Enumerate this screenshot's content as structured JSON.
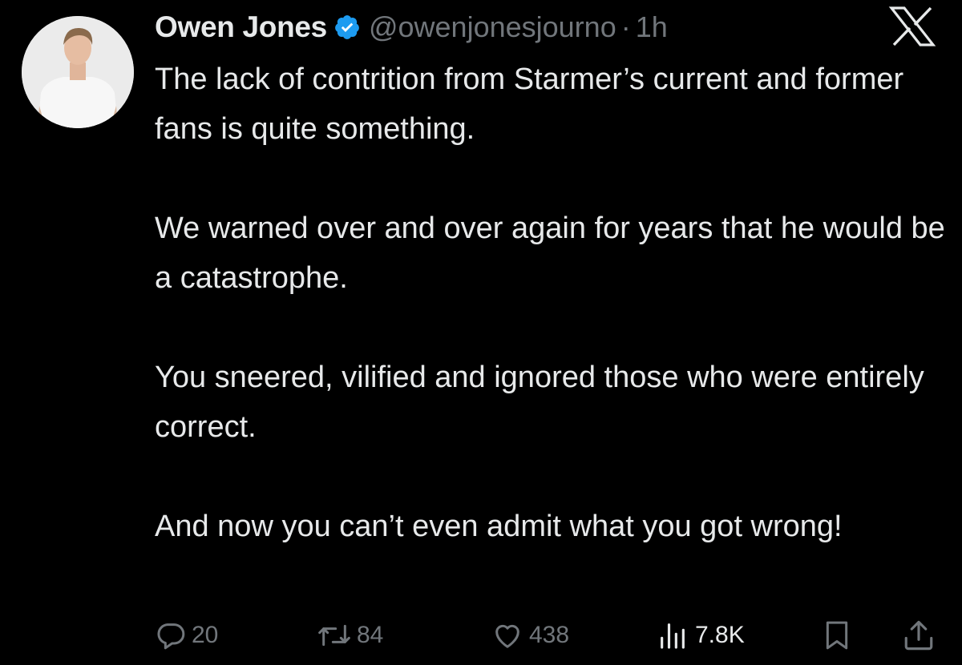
{
  "tweet": {
    "author_name": "Owen Jones",
    "handle": "@owenjonesjourno",
    "separator": "·",
    "time": "1h",
    "paragraphs": [
      "The lack of contrition from Starmer’s current and former fans is quite something.",
      "We warned over and over again for years that he would be a catastrophe.",
      "You sneered, vilified and ignored those who were entirely correct.",
      "And now you can’t even admit what you got wrong!"
    ]
  },
  "actions": {
    "replies": "20",
    "reposts": "84",
    "likes": "438",
    "views": "7.8K"
  },
  "icons": {
    "verified": "verified-badge-icon",
    "logo": "x-logo-icon",
    "reply": "reply-icon",
    "repost": "repost-icon",
    "like": "heart-icon",
    "views": "views-chart-icon",
    "bookmark": "bookmark-icon",
    "share": "share-icon"
  },
  "colors": {
    "background": "#000000",
    "text": "#e7e9ea",
    "secondary": "#71767b",
    "verified": "#1d9bf0"
  }
}
